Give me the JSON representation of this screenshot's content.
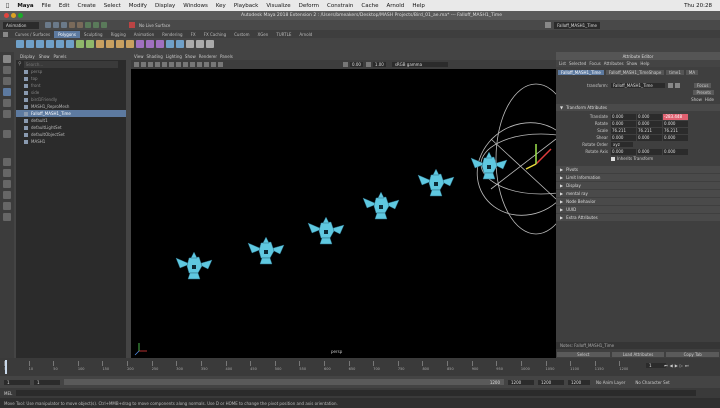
{
  "mac_menu": {
    "app": "Maya",
    "items": [
      "File",
      "Edit",
      "Create",
      "Select",
      "Modify",
      "Display",
      "Windows",
      "Key",
      "Playback",
      "Visualize",
      "Deform",
      "Constrain",
      "Cache",
      "Arnold",
      "Help"
    ],
    "clock": "Thu 20:28"
  },
  "window": {
    "title": "Autodesk Maya 2018 Extension 2 : /Users/bmeakers/Desktop/MASH Projects/Bird_01_ae.ma* --- Falloff_MASH1_Time",
    "workspace": "Animation",
    "live_surface": "No Live Surface",
    "falloff_field": "Falloff_MASH1_Time"
  },
  "shelf_tabs": {
    "items": [
      "Curves / Surfaces",
      "Polygons",
      "Sculpting",
      "Rigging",
      "Animation",
      "Rendering",
      "FX",
      "FX Caching",
      "Custom",
      "XGen",
      "TURTLE",
      "Arnold"
    ],
    "active": "Polygons"
  },
  "outliner": {
    "menu": [
      "Display",
      "Show",
      "Panels"
    ],
    "search_placeholder": "Search...",
    "items": [
      {
        "label": "persp",
        "state": "dim"
      },
      {
        "label": "top",
        "state": "dim"
      },
      {
        "label": "front",
        "state": "dim"
      },
      {
        "label": "side",
        "state": "dim"
      },
      {
        "label": "bird1Friendly",
        "state": "dim"
      },
      {
        "label": "MASH1_ReproMesh",
        "state": "normal"
      },
      {
        "label": "Falloff_MASH1_Time",
        "state": "selected"
      },
      {
        "label": "default1",
        "state": "normal"
      },
      {
        "label": "defaultLightSet",
        "state": "normal"
      },
      {
        "label": "defaultObjectSet",
        "state": "normal"
      },
      {
        "label": "MASH1",
        "state": "normal"
      }
    ]
  },
  "viewport": {
    "menu": [
      "View",
      "Shading",
      "Lighting",
      "Show",
      "Renderer",
      "Panels"
    ],
    "exposure": "0.00",
    "gamma": "1.00",
    "color_space": "sRGB gamma",
    "camera_label": "persp"
  },
  "attribute_editor": {
    "title": "Attribute Editor",
    "menu": [
      "List",
      "Selected",
      "Focus",
      "Attributes",
      "Show",
      "Help"
    ],
    "tabs": [
      "Falloff_MASH1_Time",
      "Falloff_MASH1_TimeShape",
      "time1",
      "MA"
    ],
    "transform_label": "transform:",
    "transform_value": "Falloff_MASH1_Time",
    "buttons": [
      "Focus",
      "Presets"
    ],
    "show_label": "Show",
    "hide_label": "Hide",
    "section_title": "Transform Attributes",
    "attrs": [
      {
        "label": "Translate",
        "values": [
          "0.000",
          "0.000",
          "-283.448"
        ]
      },
      {
        "label": "Rotate",
        "values": [
          "0.000",
          "0.000",
          "0.000"
        ]
      },
      {
        "label": "Scale",
        "values": [
          "76.211",
          "76.211",
          "76.211"
        ]
      },
      {
        "label": "Shear",
        "values": [
          "0.000",
          "0.000",
          "0.000"
        ]
      }
    ],
    "rotate_order_label": "Rotate Order",
    "rotate_order_value": "xyz",
    "rotate_axis_label": "Rotate Axis",
    "rotate_axis_values": [
      "0.000",
      "0.000",
      "0.000"
    ],
    "inherits_label": "Inherits Transform",
    "sections": [
      "Pivots",
      "Limit Information",
      "Display",
      "mental ray",
      "Node Behavior",
      "UUID",
      "Extra Attributes"
    ],
    "notes": "Notes: Falloff_MASH1_Time",
    "bottom_buttons": [
      "Select",
      "Load Attributes",
      "Copy Tab"
    ]
  },
  "timeline": {
    "ticks": [
      "5",
      "10",
      "50",
      "100",
      "150",
      "200",
      "250",
      "300",
      "350",
      "400",
      "450",
      "500",
      "550",
      "600",
      "650",
      "700",
      "750",
      "800",
      "850",
      "900",
      "950",
      "1000",
      "1050",
      "1100",
      "1150",
      "1200"
    ],
    "end": "1200",
    "current_frame": "1"
  },
  "range": {
    "start": "1",
    "inner_start": "1",
    "inner_end": "1200",
    "end_a": "1200",
    "end_b": "1200",
    "fps": "1200",
    "anim_layer": "No Anim Layer",
    "char_set": "No Character Set"
  },
  "command_line": {
    "label": "MEL"
  },
  "help_line": "Move Tool: Use manipulator to move object(s). Ctrl+MMB+drag to move components along normals. Use D or HOME to change the pivot position and axis orientation.",
  "colors": {
    "selection": "#5d7aa0",
    "bird": "#5fc8e0",
    "translate_z_field": "#e06070"
  }
}
